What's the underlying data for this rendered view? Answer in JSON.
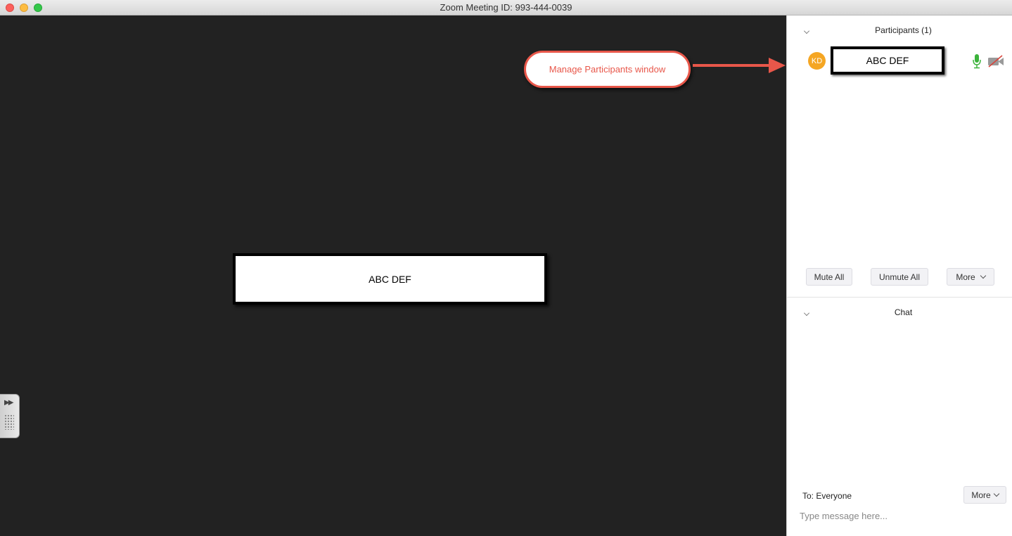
{
  "window": {
    "title": "Zoom Meeting ID: 993-444-0039"
  },
  "video": {
    "active_speaker_name": "ABC DEF"
  },
  "callout": {
    "text": "Manage Participants window"
  },
  "participants": {
    "header": "Participants (1)",
    "list": [
      {
        "initials": "KD",
        "name": "ABC DEF",
        "mic": "unmuted",
        "video": "off"
      }
    ],
    "buttons": {
      "mute_all": "Mute All",
      "unmute_all": "Unmute All",
      "more": "More"
    }
  },
  "chat": {
    "header": "Chat",
    "to_label": "To: Everyone",
    "more": "More",
    "placeholder": "Type message here..."
  },
  "colors": {
    "avatar": "#f5a623",
    "callout": "#e8574a",
    "mic_on": "#3bb33b",
    "video_off": "#d9443b"
  }
}
